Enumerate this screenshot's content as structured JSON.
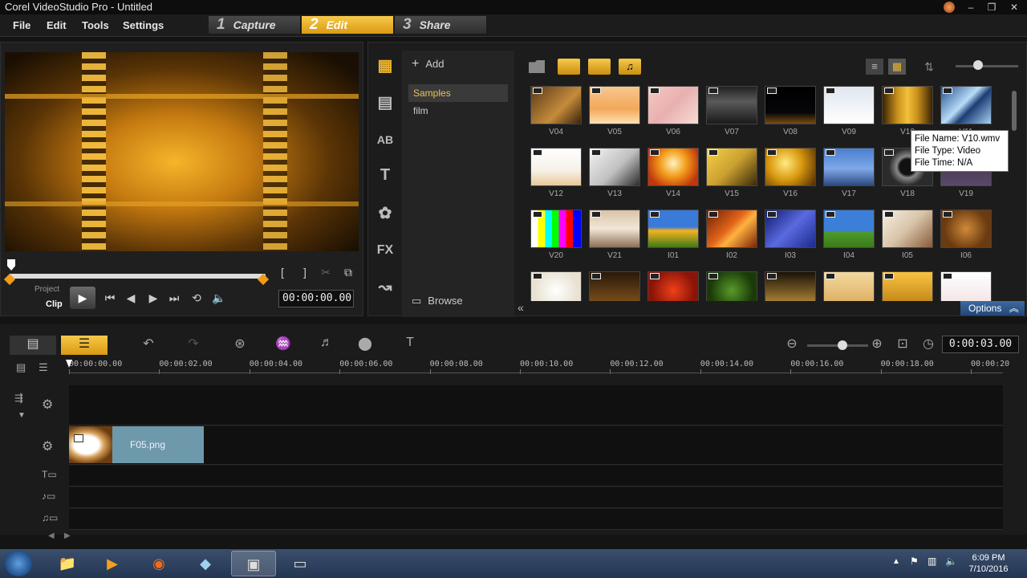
{
  "window": {
    "title": "Corel VideoStudio Pro - Untitled",
    "min_glyph": "–",
    "max_glyph": "❐",
    "close_glyph": "✕"
  },
  "menu": {
    "items": [
      "File",
      "Edit",
      "Tools",
      "Settings"
    ]
  },
  "steps": [
    {
      "num": "1",
      "label": "Capture",
      "active": false
    },
    {
      "num": "2",
      "label": "Edit",
      "active": true
    },
    {
      "num": "3",
      "label": "Share",
      "active": false
    }
  ],
  "player": {
    "project_label": "Project",
    "clip_label": "Clip",
    "timecode": "00:00:00.00",
    "mark_in": "[",
    "mark_out": "]"
  },
  "library": {
    "add_label": "Add",
    "browse_label": "Browse",
    "options_label": "Options",
    "folders": [
      "Samples",
      "film"
    ],
    "selected_folder": "Samples",
    "side_icons": [
      {
        "name": "media-icon",
        "glyph": "▦"
      },
      {
        "name": "instant-project-icon",
        "glyph": "▤"
      },
      {
        "name": "transition-icon",
        "glyph": "AB"
      },
      {
        "name": "title-icon",
        "glyph": "T"
      },
      {
        "name": "graphic-icon",
        "glyph": "✿"
      },
      {
        "name": "filter-icon",
        "glyph": "FX"
      },
      {
        "name": "path-icon",
        "glyph": "↝"
      }
    ],
    "thumbnails": [
      {
        "label": "V04",
        "bg": "linear-gradient(135deg,#5a3a14,#c48b3c 60%,#3a2208)"
      },
      {
        "label": "V05",
        "bg": "linear-gradient(#f6c890,#f3a75a 60%,#fce2b4)"
      },
      {
        "label": "V06",
        "bg": "linear-gradient(135deg,#f4c8c0,#e8b0b0 50%,#f7dcd4)"
      },
      {
        "label": "V07",
        "bg": "linear-gradient(#222,#5a5a5a 40%,#1a1a1a)"
      },
      {
        "label": "V08",
        "bg": "linear-gradient(#000,#05060a 70%,#7a4a10)"
      },
      {
        "label": "V09",
        "bg": "linear-gradient(#dfe6ee,#ffffff)"
      },
      {
        "label": "V10",
        "bg": "linear-gradient(90deg,#3a2404,#c9901c 30%,#f3c13c 50%,#c9901c 70%,#3a2404)"
      },
      {
        "label": "V11",
        "bg": "linear-gradient(135deg,#1f4f8c,#b8dcf8 45%,#1b3d74 60%,#a7d0f2)"
      },
      {
        "label": "V12",
        "bg": "linear-gradient(#ffffff,#f6f1e6 60%,#e9c79a)"
      },
      {
        "label": "V13",
        "bg": "linear-gradient(135deg,#f3f3f3,#bfbfbf 55%,#2b2b2b)"
      },
      {
        "label": "V14",
        "bg": "radial-gradient(circle at 50% 40%,#fff4c0,#f29c1a 40%,#c0360e 80%)"
      },
      {
        "label": "V15",
        "bg": "linear-gradient(135deg,#f7d048,#caa030 50%,#3a2a08)"
      },
      {
        "label": "V16",
        "bg": "radial-gradient(circle at 40% 40%,#ffeb80,#d9980f 45%,#4a2a05)"
      },
      {
        "label": "V17",
        "bg": "linear-gradient(#4a7fd0,#7fa8e8 55%,#2a4a80)"
      },
      {
        "label": "V18",
        "bg": "radial-gradient(circle,#111 25%,#888 35%,#2b2b2b 60%)"
      },
      {
        "label": "V19",
        "bg": "linear-gradient(#3a2a3e,#5a4a6a)"
      },
      {
        "label": "V20",
        "bg": "linear-gradient(90deg,#fff 14%,#ff0 14% 28%,#0ff 28% 42%,#0f0 42% 56%,#f0f 56% 70%,#f00 70% 84%,#00f 84%)"
      },
      {
        "label": "V21",
        "bg": "linear-gradient(#d9c3a8,#f2e6d8 50%,#8c7058)"
      },
      {
        "label": "I01",
        "bg": "linear-gradient(#3a7ad8 45%,#f4b320 55%,#3e7a1a)"
      },
      {
        "label": "I02",
        "bg": "linear-gradient(135deg,#6a1f06,#e2641a 45%,#ffb240 60%,#7a2208)"
      },
      {
        "label": "I03",
        "bg": "linear-gradient(135deg,#0e1a6a,#5a6ae0 50%,#1c2a8a)"
      },
      {
        "label": "I04",
        "bg": "linear-gradient(#3c7fd8 55%,#4f9a2a 60%,#3a7a1a)"
      },
      {
        "label": "I05",
        "bg": "linear-gradient(135deg,#f5eee2,#d8c4a8 50%,#8a5a3a)"
      },
      {
        "label": "I06",
        "bg": "radial-gradient(circle at 50% 50%,#d08a3a,#6a3a10 70%)"
      },
      {
        "label": "",
        "bg": "radial-gradient(circle,#fff,#e9e2d2 70%)"
      },
      {
        "label": "",
        "bg": "linear-gradient(#2a1808,#8a5a20)"
      },
      {
        "label": "",
        "bg": "radial-gradient(circle,#f0401a,#8a1408 70%)"
      },
      {
        "label": "",
        "bg": "radial-gradient(circle,#5a9a2a,#1a3a08 70%)"
      },
      {
        "label": "",
        "bg": "linear-gradient(#1a1206,#c99a40)"
      },
      {
        "label": "",
        "bg": "linear-gradient(#f3d8a0,#d9a856)"
      },
      {
        "label": "",
        "bg": "linear-gradient(#f9c341,#b87a10)"
      },
      {
        "label": "",
        "bg": "linear-gradient(#fff,#f0e0e0)"
      }
    ],
    "tooltip": {
      "name": "File Name: V10.wmv",
      "type": "File Type: Video",
      "time": "File Time: N/A"
    }
  },
  "timeline": {
    "duration": "0:00:03.00",
    "ruler_ticks": [
      "00:00:00.00",
      "00:00:02.00",
      "00:00:04.00",
      "00:00:06.00",
      "00:00:08.00",
      "00:00:10.00",
      "00:00:12.00",
      "00:00:14.00",
      "00:00:16.00",
      "00:00:18.00",
      "00:00:20"
    ],
    "clip_name": "F05.png"
  },
  "taskbar": {
    "time": "6:09 PM",
    "date": "7/10/2016"
  },
  "colors": {
    "accent": "#f1b52c",
    "options_blue": "#2f5b8f"
  }
}
